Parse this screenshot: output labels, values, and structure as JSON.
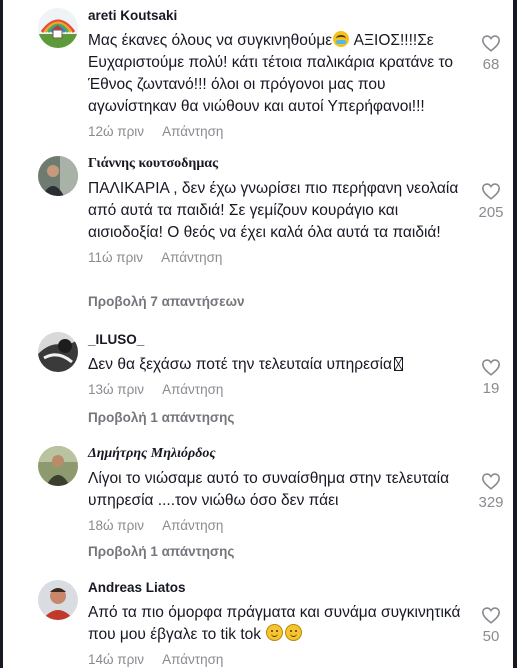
{
  "comments": [
    {
      "username": "areti Koutsaki",
      "text_before_emoji": "Μας έκανες όλους να συγκινηθούμε",
      "emoji": "teary-face-emoji",
      "text_after_emoji": " ΑΞΙΟΣ!!!!Σε Ευχαριστούμε πολύ! κάτι τέτοια παλικάρια κρατάνε το Έθνος ζωντανό!!! όλοι οι πρόγονοι μας που αγωνίστηκαν θα νιώθουν και αυτοί Υπερήφανοι!!!",
      "time": "12ώ πριν",
      "reply_label": "Απάντηση",
      "likes": "68"
    },
    {
      "username": "Γιάννης κουτσοδημας",
      "text": "ΠΑΛΙΚΑΡΙΑ , δεν έχω γνωρίσει πιο περήφανη νεολαία από αυτά τα παιδιά! Σε γεμίζουν κουράγιο και αισιοδοξία! Ο θεός να έχει καλά όλα αυτά τα παιδιά!",
      "time": "11ώ πριν",
      "reply_label": "Απάντηση",
      "likes": "205",
      "view_replies": "Προβολή 7 απαντήσεων"
    },
    {
      "username": "_ILUSO_",
      "text": "Δεν θα ξεχάσω ποτέ την τελευταία υπηρεσία",
      "time": "13ώ πριν",
      "reply_label": "Απάντηση",
      "likes": "19",
      "view_replies": "Προβολή 1 απάντησης"
    },
    {
      "username": "Δημήτρης Μηλιόρδος",
      "text": "Λίγοι το νιώσαμε αυτό το συναίσθημα στην τελευταία υπηρεσία ....τον νιώθω όσο δεν πάει",
      "time": "18ώ πριν",
      "reply_label": "Απάντηση",
      "likes": "329",
      "view_replies": "Προβολή 1 απάντησης"
    },
    {
      "username": "Andreas Liatos",
      "text": "Από τα πιο όμορφα πράγματα και συνάμα συγκινητικά που μου έβγαλε το tik tok",
      "emojis": [
        "smiling-face-emoji",
        "smiling-face-emoji"
      ],
      "time": "14ώ πριν",
      "reply_label": "Απάντηση",
      "likes": "50"
    }
  ],
  "colors": {
    "text": "#161823",
    "muted": "#8a8b91",
    "view_replies": "#75767c",
    "heart_outline": "#8a8b91"
  }
}
